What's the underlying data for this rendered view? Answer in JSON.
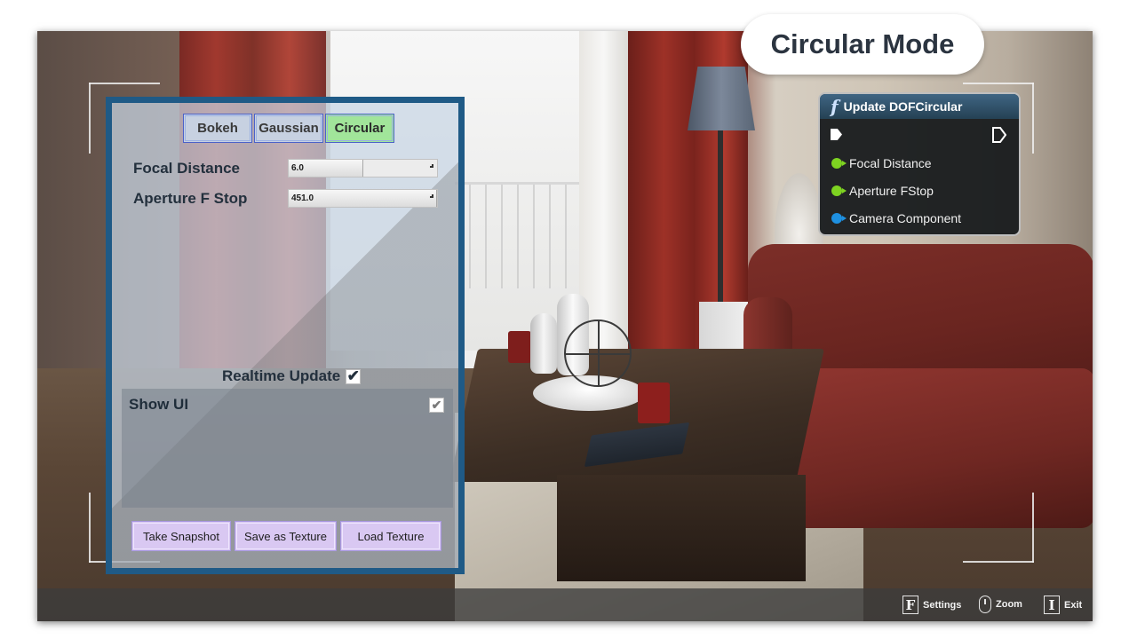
{
  "mode_badge": {
    "label": "Circular Mode"
  },
  "panel": {
    "tabs": [
      {
        "label": "Bokeh",
        "active": false
      },
      {
        "label": "Gaussian",
        "active": false
      },
      {
        "label": "Circular",
        "active": true
      }
    ],
    "params": [
      {
        "label": "Focal Distance",
        "value": "6.0",
        "fill_fraction": 0.5
      },
      {
        "label": "Aperture F Stop",
        "value": "451.0",
        "fill_fraction": 1.0
      }
    ],
    "realtime_update": {
      "label": "Realtime Update",
      "checked": true
    },
    "show_ui": {
      "label": "Show UI",
      "checked": true
    },
    "buttons": [
      {
        "label": "Take Snapshot"
      },
      {
        "label": "Save as Texture"
      },
      {
        "label": "Load Texture"
      }
    ]
  },
  "blueprint_node": {
    "title": "Update DOFCircular",
    "function_glyph": "f",
    "pins": [
      {
        "label": "Focal Distance",
        "color": "#7ed321"
      },
      {
        "label": "Aperture FStop",
        "color": "#7ed321"
      },
      {
        "label": "Camera Component",
        "color": "#1e90e0"
      }
    ]
  },
  "bottom_bar": {
    "hints": [
      {
        "key": "F",
        "label": "Settings",
        "icon": "keycap"
      },
      {
        "key": "",
        "label": "Zoom",
        "icon": "mouse-icon"
      },
      {
        "key": "I",
        "label": "Exit",
        "icon": "keycap"
      }
    ]
  },
  "colors": {
    "panel_border": "#1f5a86",
    "tab_active": "#a1e59a",
    "button_bg": "#d9c8f2",
    "node_header": "#254154"
  }
}
